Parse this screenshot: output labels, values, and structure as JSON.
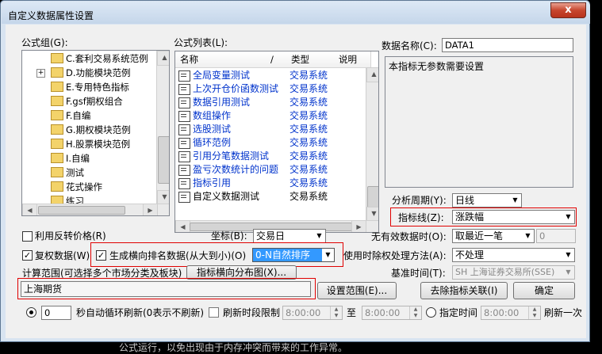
{
  "window": {
    "title": "自定义数据属性设置",
    "close_glyph": "x"
  },
  "background_text": "公式运行，以免出现由于内存冲突而带来的工作异常。",
  "formula_group": {
    "label": "公式组(G):",
    "items": [
      {
        "label": "C.套利交易系统范例"
      },
      {
        "label": "D.功能模块范例"
      },
      {
        "label": "E.专用特色指标"
      },
      {
        "label": "F.gsf期权组合"
      },
      {
        "label": "F.自编"
      },
      {
        "label": "G.期权模块范例"
      },
      {
        "label": "H.股票模块范例"
      },
      {
        "label": "I.自编"
      },
      {
        "label": "测试"
      },
      {
        "label": "花式操作"
      },
      {
        "label": "练习"
      }
    ],
    "expander": "+"
  },
  "formula_list": {
    "label": "公式列表(L):",
    "columns": {
      "name": "名称",
      "sort_mark": "/",
      "type": "类型",
      "desc": "说明"
    },
    "rows": [
      {
        "name": "全局变量测试",
        "type": "交易系统"
      },
      {
        "name": "上次开仓价函数测试",
        "type": "交易系统"
      },
      {
        "name": "数据引用测试",
        "type": "交易系统"
      },
      {
        "name": "数组操作",
        "type": "交易系统"
      },
      {
        "name": "选股测试",
        "type": "交易系统"
      },
      {
        "name": "循环范例",
        "type": "交易系统"
      },
      {
        "name": "引用分笔数据测试",
        "type": "交易系统"
      },
      {
        "name": "盈亏次数统计的问题",
        "type": "交易系统"
      },
      {
        "name": "指标引用",
        "type": "交易系统"
      },
      {
        "name": "自定义数据测试",
        "type": "交易系统"
      }
    ]
  },
  "data_name": {
    "label": "数据名称(C):",
    "value": "DATA1"
  },
  "description": "本指标无参数需要设置",
  "analysis_period": {
    "label": "分析周期(Y):",
    "value": "日线"
  },
  "indicator_line": {
    "label": "指标线(Z):",
    "value": "涨跌幅"
  },
  "reverse_price": {
    "label": "利用反转价格(R)",
    "checked": false
  },
  "coordinate": {
    "label": "坐标(B):",
    "value": "交易日"
  },
  "invalid_data": {
    "label": "无有效数据时(O):",
    "value": "取最近一笔",
    "extra_value": "0"
  },
  "restore_rights": {
    "label": "复权数据(W)",
    "checked": true,
    "mark": "✓"
  },
  "rank_data": {
    "label": "生成横向排名数据(从大到小)(O)",
    "checked": true,
    "mark": "✓",
    "value": "0-N自然排序"
  },
  "rights_method": {
    "label": "使用时除权处理方法(A):",
    "value": "不处理"
  },
  "calc_range": {
    "label": "计算范围(可选择多个市场分类及板块)",
    "value": "上海期货"
  },
  "dist_button": "指标横向分布图(X)...",
  "base_time": {
    "label": "基准时间(T):",
    "value": "SH 上海证券交易所(SSE)"
  },
  "set_range_button": "设置范围(E)...",
  "remove_link_button": "去除指标关联(I)",
  "ok_button": "确定",
  "auto_refresh": {
    "value": "0",
    "label": "秒自动循环刷新(0表示不刷新)"
  },
  "refresh_limit": {
    "label": "刷新时段限制",
    "from": "8:00:00",
    "to_label": "至",
    "to": "8:00:00"
  },
  "fixed_time": {
    "label": "指定时间",
    "value": "8:00:00",
    "suffix": "刷新一次"
  },
  "glyphs": {
    "down": "▼",
    "up": "▲",
    "left": "◀",
    "right": "▶"
  }
}
